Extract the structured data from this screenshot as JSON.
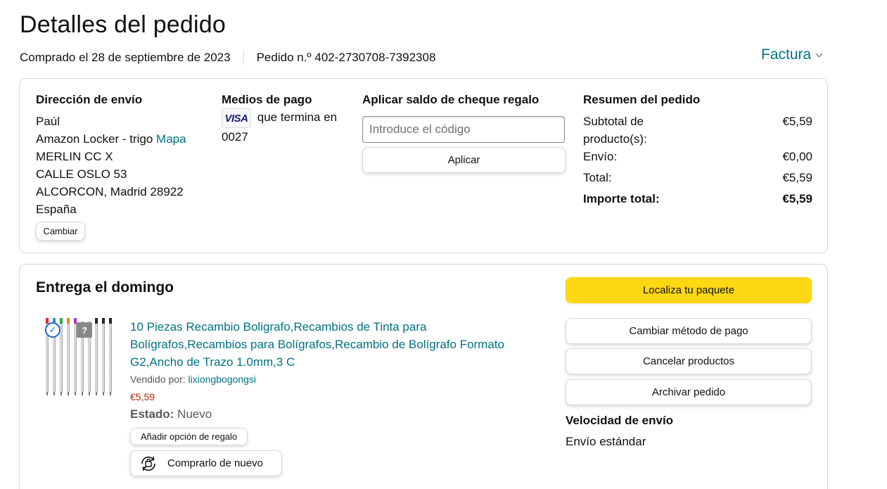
{
  "header": {
    "title": "Detalles del pedido",
    "purchased": "Comprado el 28 de septiembre de 2023",
    "order_number": "Pedido n.º 402-2730708-7392308",
    "invoice_label": "Factura"
  },
  "shipping": {
    "heading": "Dirección de envío",
    "name": "Paúl",
    "line1_text": "Amazon Locker - trigo",
    "map_link": "Mapa",
    "line2": "MERLIN CC X",
    "line3": "CALLE OSLO 53",
    "line4": "ALCORCON, Madrid 28922",
    "country": "España",
    "change_button": "Cambiar"
  },
  "payment": {
    "heading": "Medios de pago",
    "card_brand": "VISA",
    "ends_with_text": "que termina en",
    "last_digits": "0027"
  },
  "gift_card": {
    "heading": "Aplicar saldo de cheque regalo",
    "placeholder": "Introduce el código",
    "apply_button": "Aplicar"
  },
  "summary": {
    "heading": "Resumen del pedido",
    "subtotal_label_1": "Subtotal de",
    "subtotal_label_2": "producto(s):",
    "subtotal_value": "€5,59",
    "shipping_label": "Envío:",
    "shipping_value": "€0,00",
    "total_label": "Total:",
    "total_value": "€5,59",
    "grand_total_label": "Importe total:",
    "grand_total_value": "€5,59"
  },
  "delivery": {
    "heading": "Entrega el domingo",
    "product": {
      "title": "10 Piezas Recambio Boligrafo,Recambios de Tinta para Bolígrafos,Recambios para Bolígrafos,Recambio de Bolígrafo Formato G2,Ancho de Trazo 1.0mm,3 C",
      "sold_by_label": "Vendido por:",
      "seller": "lixiongbogongsi",
      "price": "€5,59",
      "state_label": "Estado:",
      "state_value": "Nuevo",
      "gift_button": "Añadir opción de regalo",
      "rebuy_button": "Comprarlo de nuevo",
      "badge_question": "?"
    },
    "actions": {
      "track": "Localiza tu paquete",
      "change_payment": "Cambiar método de pago",
      "cancel": "Cancelar productos",
      "archive": "Archivar pedido"
    },
    "speed_heading": "Velocidad de envío",
    "speed_value": "Envío estándar"
  },
  "colors": {
    "link": "#007185",
    "price": "#b12704",
    "primary_button": "#ffd814",
    "border": "#d5d9d9",
    "text": "#0f1111"
  },
  "icons": [
    "chevron-down-icon",
    "visa-card-icon",
    "check-circle-icon",
    "question-icon",
    "rebuy-icon"
  ]
}
